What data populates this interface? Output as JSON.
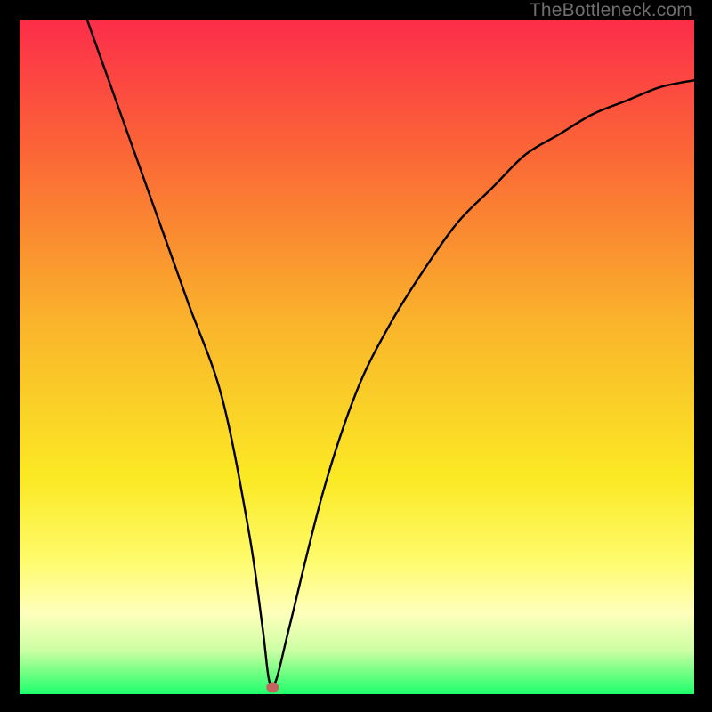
{
  "watermark": "TheBottleneck.com",
  "chart_data": {
    "type": "line",
    "title": "",
    "xlabel": "",
    "ylabel": "",
    "xlim": [
      0,
      100
    ],
    "ylim": [
      0,
      100
    ],
    "series": [
      {
        "name": "curve",
        "x": [
          10,
          15,
          20,
          25,
          30,
          34,
          36,
          37,
          38,
          40,
          45,
          50,
          55,
          60,
          65,
          70,
          75,
          80,
          85,
          90,
          95,
          100
        ],
        "y": [
          100,
          86,
          72,
          58,
          44,
          24,
          10,
          2,
          2,
          10,
          30,
          45,
          55,
          63,
          70,
          75,
          80,
          83,
          86,
          88,
          90,
          91
        ]
      }
    ],
    "marker": {
      "x": 37.5,
      "y": 1,
      "color": "#c5645f"
    },
    "gradient_stops": [
      {
        "offset": 0.0,
        "color": "#fc2d4a"
      },
      {
        "offset": 0.2,
        "color": "#fb6736"
      },
      {
        "offset": 0.45,
        "color": "#fab42b"
      },
      {
        "offset": 0.68,
        "color": "#fbe924"
      },
      {
        "offset": 0.8,
        "color": "#fefb6a"
      },
      {
        "offset": 0.88,
        "color": "#feffbb"
      },
      {
        "offset": 0.935,
        "color": "#cdffa4"
      },
      {
        "offset": 0.965,
        "color": "#7bff86"
      },
      {
        "offset": 1.0,
        "color": "#1dff6d"
      }
    ]
  }
}
